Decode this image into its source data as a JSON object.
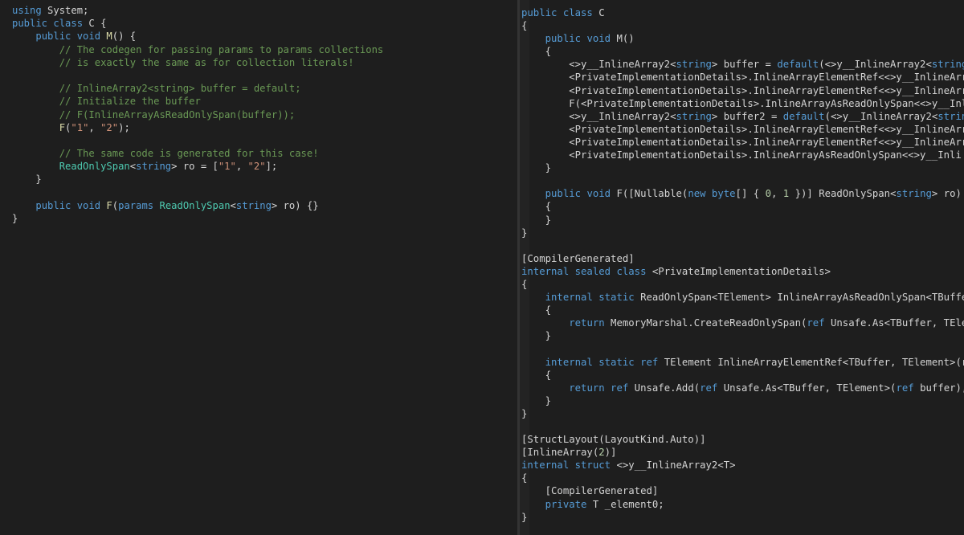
{
  "colors": {
    "background": "#1e1e1e",
    "plain": "#d4d4d4",
    "keyword": "#569cd6",
    "type": "#4ec9b0",
    "method": "#dcdcaa",
    "string": "#ce9178",
    "comment": "#6a9955",
    "number": "#b5cea8"
  },
  "left_editor": {
    "lines": [
      [
        {
          "t": "kw",
          "v": "using"
        },
        {
          "t": "plain",
          "v": " System;"
        }
      ],
      [
        {
          "t": "kw",
          "v": "public class"
        },
        {
          "t": "plain",
          "v": " C {"
        }
      ],
      [
        {
          "t": "plain",
          "v": "    "
        },
        {
          "t": "kw",
          "v": "public void"
        },
        {
          "t": "plain",
          "v": " "
        },
        {
          "t": "method",
          "v": "M"
        },
        {
          "t": "plain",
          "v": "() {"
        }
      ],
      [
        {
          "t": "plain",
          "v": "        "
        },
        {
          "t": "comment",
          "v": "// The codegen for passing params to params collections"
        }
      ],
      [
        {
          "t": "plain",
          "v": "        "
        },
        {
          "t": "comment",
          "v": "// is exactly the same as for collection literals!"
        }
      ],
      [],
      [
        {
          "t": "plain",
          "v": "        "
        },
        {
          "t": "comment",
          "v": "// InlineArray2<string> buffer = default;"
        }
      ],
      [
        {
          "t": "plain",
          "v": "        "
        },
        {
          "t": "comment",
          "v": "// Initialize the buffer"
        }
      ],
      [
        {
          "t": "plain",
          "v": "        "
        },
        {
          "t": "comment",
          "v": "// F(InlineArrayAsReadOnlySpan(buffer));"
        }
      ],
      [
        {
          "t": "plain",
          "v": "        "
        },
        {
          "t": "method",
          "v": "F"
        },
        {
          "t": "plain",
          "v": "("
        },
        {
          "t": "str",
          "v": "\"1\""
        },
        {
          "t": "plain",
          "v": ", "
        },
        {
          "t": "str",
          "v": "\"2\""
        },
        {
          "t": "plain",
          "v": ");"
        }
      ],
      [],
      [
        {
          "t": "plain",
          "v": "        "
        },
        {
          "t": "comment",
          "v": "// The same code is generated for this case!"
        }
      ],
      [
        {
          "t": "plain",
          "v": "        "
        },
        {
          "t": "type",
          "v": "ReadOnlySpan"
        },
        {
          "t": "plain",
          "v": "<"
        },
        {
          "t": "kw",
          "v": "string"
        },
        {
          "t": "plain",
          "v": "> ro = ["
        },
        {
          "t": "str",
          "v": "\"1\""
        },
        {
          "t": "plain",
          "v": ", "
        },
        {
          "t": "str",
          "v": "\"2\""
        },
        {
          "t": "plain",
          "v": "];"
        }
      ],
      [
        {
          "t": "plain",
          "v": "    }"
        }
      ],
      [],
      [
        {
          "t": "plain",
          "v": "    "
        },
        {
          "t": "kw",
          "v": "public void"
        },
        {
          "t": "plain",
          "v": " "
        },
        {
          "t": "method",
          "v": "F"
        },
        {
          "t": "plain",
          "v": "("
        },
        {
          "t": "kw",
          "v": "params"
        },
        {
          "t": "plain",
          "v": " "
        },
        {
          "t": "type",
          "v": "ReadOnlySpan"
        },
        {
          "t": "plain",
          "v": "<"
        },
        {
          "t": "kw",
          "v": "string"
        },
        {
          "t": "plain",
          "v": "> ro) {}"
        }
      ],
      [
        {
          "t": "plain",
          "v": "}"
        }
      ]
    ]
  },
  "right_editor": {
    "lines": [
      [
        {
          "t": "kw",
          "v": "public class"
        },
        {
          "t": "plain",
          "v": " C"
        }
      ],
      [
        {
          "t": "plain",
          "v": "{"
        }
      ],
      [
        {
          "t": "plain",
          "v": "    "
        },
        {
          "t": "kw",
          "v": "public void"
        },
        {
          "t": "plain",
          "v": " M()"
        }
      ],
      [
        {
          "t": "plain",
          "v": "    {"
        }
      ],
      [
        {
          "t": "plain",
          "v": "        <>y__InlineArray2<"
        },
        {
          "t": "kw",
          "v": "string"
        },
        {
          "t": "plain",
          "v": "> buffer = "
        },
        {
          "t": "kw",
          "v": "default"
        },
        {
          "t": "plain",
          "v": "(<>y__InlineArray2<"
        },
        {
          "t": "kw",
          "v": "string"
        }
      ],
      [
        {
          "t": "plain",
          "v": "        <PrivateImplementationDetails>.InlineArrayElementRef<<>y__InlineArr"
        }
      ],
      [
        {
          "t": "plain",
          "v": "        <PrivateImplementationDetails>.InlineArrayElementRef<<>y__InlineArr"
        }
      ],
      [
        {
          "t": "plain",
          "v": "        F(<PrivateImplementationDetails>.InlineArrayAsReadOnlySpan<<>y__Inl"
        }
      ],
      [
        {
          "t": "plain",
          "v": "        <>y__InlineArray2<"
        },
        {
          "t": "kw",
          "v": "string"
        },
        {
          "t": "plain",
          "v": "> buffer2 = "
        },
        {
          "t": "kw",
          "v": "default"
        },
        {
          "t": "plain",
          "v": "(<>y__InlineArray2<"
        },
        {
          "t": "kw",
          "v": "strin"
        }
      ],
      [
        {
          "t": "plain",
          "v": "        <PrivateImplementationDetails>.InlineArrayElementRef<<>y__InlineArr"
        }
      ],
      [
        {
          "t": "plain",
          "v": "        <PrivateImplementationDetails>.InlineArrayElementRef<<>y__InlineArr"
        }
      ],
      [
        {
          "t": "plain",
          "v": "        <PrivateImplementationDetails>.InlineArrayAsReadOnlySpan<<>y__Inli"
        }
      ],
      [
        {
          "t": "plain",
          "v": "    }"
        }
      ],
      [],
      [
        {
          "t": "plain",
          "v": "    "
        },
        {
          "t": "kw",
          "v": "public void"
        },
        {
          "t": "plain",
          "v": " F([Nullable("
        },
        {
          "t": "kw",
          "v": "new byte"
        },
        {
          "t": "plain",
          "v": "[] { "
        },
        {
          "t": "num",
          "v": "0"
        },
        {
          "t": "plain",
          "v": ", "
        },
        {
          "t": "num",
          "v": "1"
        },
        {
          "t": "plain",
          "v": " })] ReadOnlySpan<"
        },
        {
          "t": "kw",
          "v": "string"
        },
        {
          "t": "plain",
          "v": "> ro)"
        }
      ],
      [
        {
          "t": "plain",
          "v": "    {"
        }
      ],
      [
        {
          "t": "plain",
          "v": "    }"
        }
      ],
      [
        {
          "t": "plain",
          "v": "}"
        }
      ],
      [],
      [
        {
          "t": "plain",
          "v": "[CompilerGenerated]"
        }
      ],
      [
        {
          "t": "kw",
          "v": "internal sealed class"
        },
        {
          "t": "plain",
          "v": " <PrivateImplementationDetails>"
        }
      ],
      [
        {
          "t": "plain",
          "v": "{"
        }
      ],
      [
        {
          "t": "plain",
          "v": "    "
        },
        {
          "t": "kw",
          "v": "internal static"
        },
        {
          "t": "plain",
          "v": " ReadOnlySpan<TElement> InlineArrayAsReadOnlySpan<TBuffe"
        }
      ],
      [
        {
          "t": "plain",
          "v": "    {"
        }
      ],
      [
        {
          "t": "plain",
          "v": "        "
        },
        {
          "t": "kw",
          "v": "return"
        },
        {
          "t": "plain",
          "v": " MemoryMarshal.CreateReadOnlySpan("
        },
        {
          "t": "kw",
          "v": "ref"
        },
        {
          "t": "plain",
          "v": " Unsafe.As<TBuffer, TEle"
        }
      ],
      [
        {
          "t": "plain",
          "v": "    }"
        }
      ],
      [],
      [
        {
          "t": "plain",
          "v": "    "
        },
        {
          "t": "kw",
          "v": "internal static ref"
        },
        {
          "t": "plain",
          "v": " TElement InlineArrayElementRef<TBuffer, TElement>(r"
        }
      ],
      [
        {
          "t": "plain",
          "v": "    {"
        }
      ],
      [
        {
          "t": "plain",
          "v": "        "
        },
        {
          "t": "kw",
          "v": "return ref"
        },
        {
          "t": "plain",
          "v": " Unsafe.Add("
        },
        {
          "t": "kw",
          "v": "ref"
        },
        {
          "t": "plain",
          "v": " Unsafe.As<TBuffer, TElement>("
        },
        {
          "t": "kw",
          "v": "ref"
        },
        {
          "t": "plain",
          "v": " buffer),"
        }
      ],
      [
        {
          "t": "plain",
          "v": "    }"
        }
      ],
      [
        {
          "t": "plain",
          "v": "}"
        }
      ],
      [],
      [
        {
          "t": "plain",
          "v": "[StructLayout(LayoutKind.Auto)]"
        }
      ],
      [
        {
          "t": "plain",
          "v": "[InlineArray("
        },
        {
          "t": "num",
          "v": "2"
        },
        {
          "t": "plain",
          "v": ")]"
        }
      ],
      [
        {
          "t": "kw",
          "v": "internal struct"
        },
        {
          "t": "plain",
          "v": " <>y__InlineArray2<T>"
        }
      ],
      [
        {
          "t": "plain",
          "v": "{"
        }
      ],
      [
        {
          "t": "plain",
          "v": "    [CompilerGenerated]"
        }
      ],
      [
        {
          "t": "plain",
          "v": "    "
        },
        {
          "t": "kw",
          "v": "private"
        },
        {
          "t": "plain",
          "v": " T _element0;"
        }
      ],
      [
        {
          "t": "plain",
          "v": "}"
        }
      ]
    ]
  }
}
